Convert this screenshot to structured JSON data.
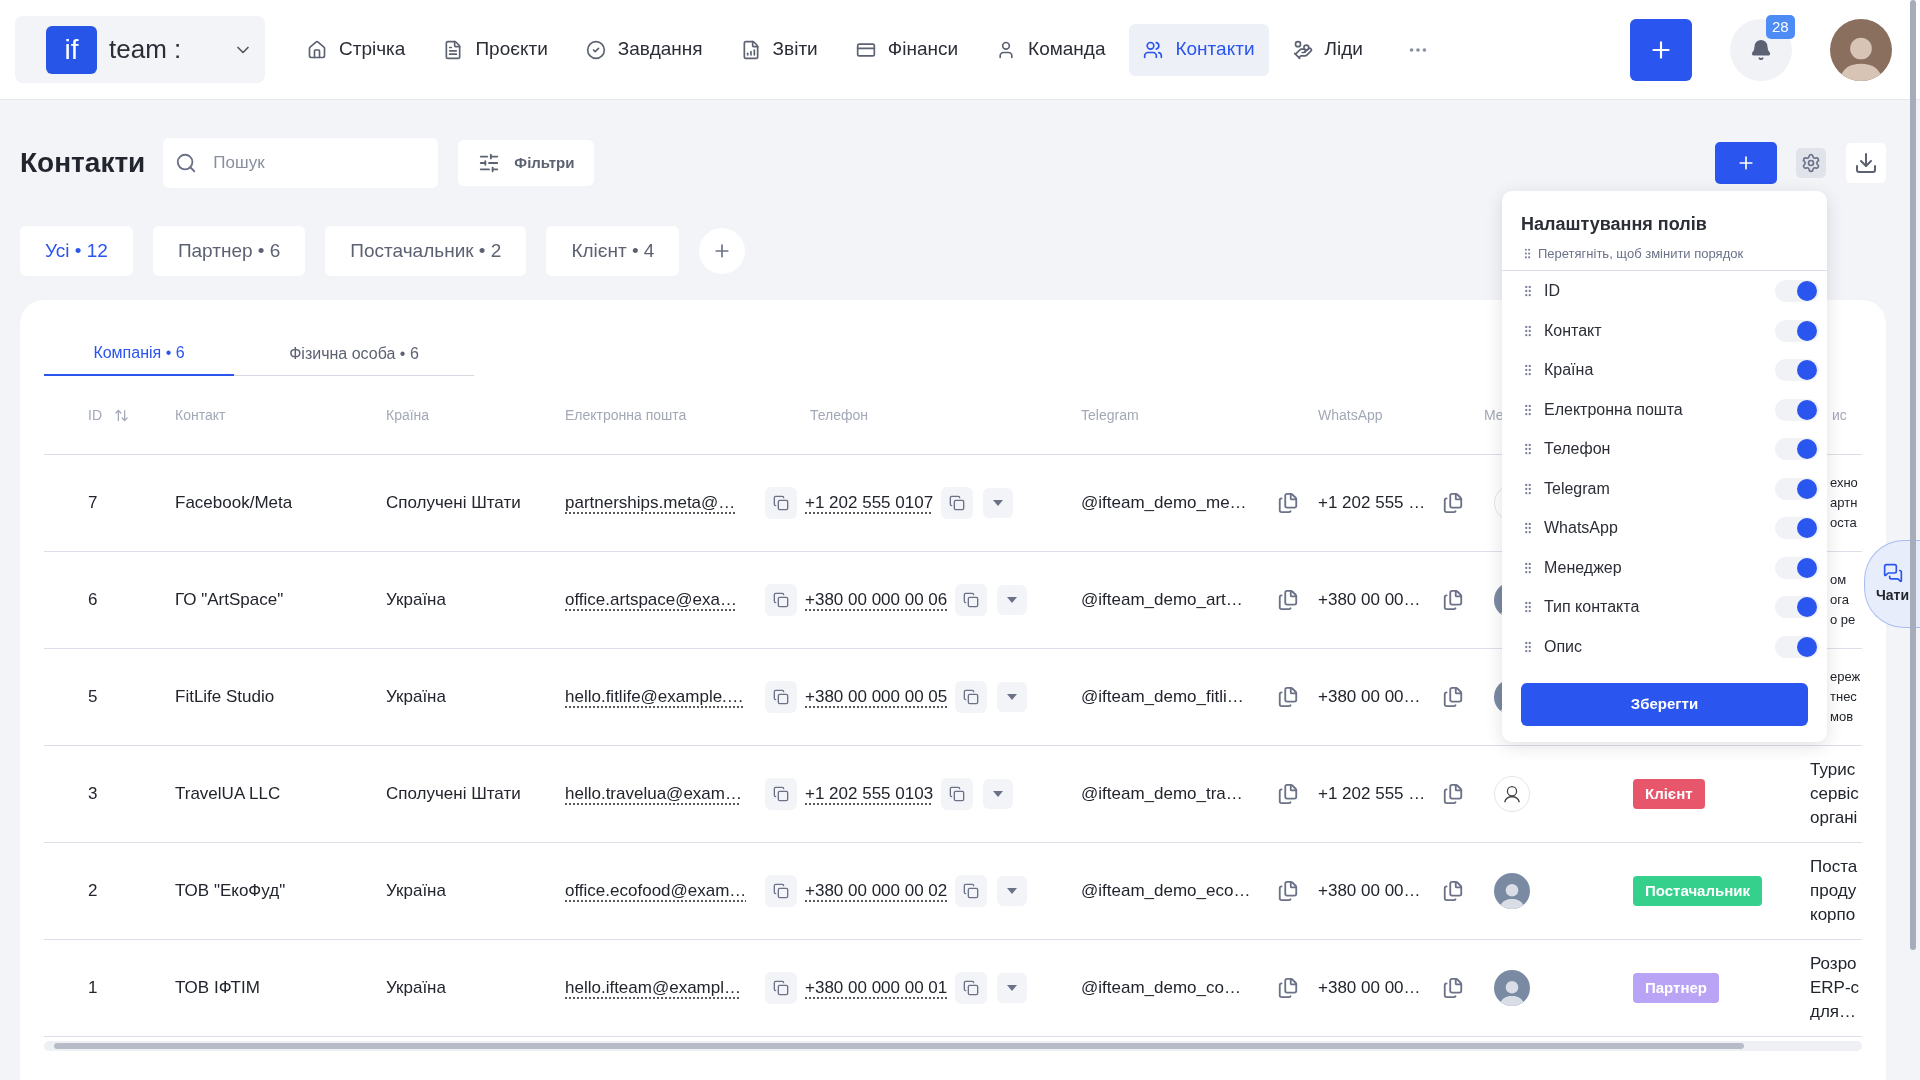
{
  "app": {
    "logo_mark": "if",
    "workspace": "team :"
  },
  "nav": [
    {
      "label": "Стрічка",
      "selected": false
    },
    {
      "label": "Проєкти",
      "selected": false
    },
    {
      "label": "Завдання",
      "selected": false
    },
    {
      "label": "Звіти",
      "selected": false
    },
    {
      "label": "Фінанси",
      "selected": false
    },
    {
      "label": "Команда",
      "selected": false
    },
    {
      "label": "Контакти",
      "selected": true
    },
    {
      "label": "Ліди",
      "selected": false
    }
  ],
  "notifications": {
    "count": "28"
  },
  "page": {
    "title": "Контакти",
    "search": {
      "placeholder": "Пошук"
    },
    "filters_button": "Фільтри"
  },
  "type_filters": [
    {
      "label": "Усі • 12",
      "selected": true
    },
    {
      "label": "Партнер • 6",
      "selected": false
    },
    {
      "label": "Постачальник • 2",
      "selected": false
    },
    {
      "label": "Клієнт • 4",
      "selected": false
    }
  ],
  "table": {
    "tabs": [
      {
        "label": "Компанія • 6",
        "selected": true
      },
      {
        "label": "Фізична особа • 6",
        "selected": false
      }
    ],
    "columns": [
      "ID",
      "Контакт",
      "Країна",
      "Електронна пошта",
      "Телефон",
      "Telegram",
      "WhatsApp",
      "Ме",
      "ис"
    ],
    "rows": [
      {
        "id": "7",
        "contact": "Facebook/Meta",
        "country": "Сполучені Штати",
        "email": "partnerships.meta@…",
        "phone": "+1 202 555 0107",
        "telegram": "@ifteam_demo_me…",
        "whatsapp": "+1 202 555 …",
        "manager": {
          "kind": "default"
        },
        "description": [
          "ехно",
          "артн",
          "оста"
        ]
      },
      {
        "id": "6",
        "contact": "ГО \"ArtSpace\"",
        "country": "Україна",
        "email": "office.artspace@exa…",
        "phone": "+380 00 000 00 06",
        "telegram": "@ifteam_demo_art…",
        "whatsapp": "+380 00 00…",
        "manager": {
          "kind": "photo"
        },
        "description": [
          "ом",
          "ога",
          "о ре"
        ]
      },
      {
        "id": "5",
        "contact": "FitLife Studio",
        "country": "Україна",
        "email": "hello.fitlife@example.…",
        "phone": "+380 00 000 00 05",
        "telegram": "@ifteam_demo_fitli…",
        "whatsapp": "+380 00 00…",
        "manager": {
          "kind": "photo"
        },
        "description": [
          "ереж",
          "тнес",
          "мов"
        ]
      },
      {
        "id": "3",
        "contact": "TravelUA LLC",
        "country": "Сполучені Штати",
        "email": "hello.travelua@exam…",
        "phone": "+1 202 555 0103",
        "telegram": "@ifteam_demo_tra…",
        "whatsapp": "+1 202 555 …",
        "manager": {
          "kind": "default"
        },
        "type": {
          "label": "Клієнт",
          "color": "#e8566c"
        },
        "description": [
          "Турис",
          "сервіс",
          "органі"
        ]
      },
      {
        "id": "2",
        "contact": "ТОВ \"ЕкоФуд\"",
        "country": "Україна",
        "email": "office.ecofood@exam…",
        "phone": "+380 00 000 00 02",
        "telegram": "@ifteam_demo_eco…",
        "whatsapp": "+380 00 00…",
        "manager": {
          "kind": "photo"
        },
        "type": {
          "label": "Постачальник",
          "color": "#34d08c"
        },
        "description": [
          "Поста",
          "проду",
          "корпо"
        ]
      },
      {
        "id": "1",
        "contact": "ТОВ ІФТІМ",
        "country": "Україна",
        "email": "hello.ifteam@exampl…",
        "phone": "+380 00 000 00 01",
        "telegram": "@ifteam_demo_co…",
        "whatsapp": "+380 00 00…",
        "manager": {
          "kind": "photo"
        },
        "type": {
          "label": "Партнер",
          "color": "#b9a3f5"
        },
        "description": [
          "Розро",
          "ERP-с",
          "для…"
        ]
      }
    ]
  },
  "field_settings": {
    "title": "Налаштування полів",
    "hint": "Перетягніть, щоб змінити порядок",
    "fields": [
      {
        "label": "ID",
        "on": true
      },
      {
        "label": "Контакт",
        "on": true
      },
      {
        "label": "Країна",
        "on": true
      },
      {
        "label": "Електронна пошта",
        "on": true
      },
      {
        "label": "Телефон",
        "on": true
      },
      {
        "label": "Telegram",
        "on": true
      },
      {
        "label": "WhatsApp",
        "on": true
      },
      {
        "label": "Менеджер",
        "on": true
      },
      {
        "label": "Тип контакта",
        "on": true
      },
      {
        "label": "Опис",
        "on": true
      }
    ],
    "save_button": "Зберегти"
  },
  "chat_button": {
    "label": "Чати"
  }
}
